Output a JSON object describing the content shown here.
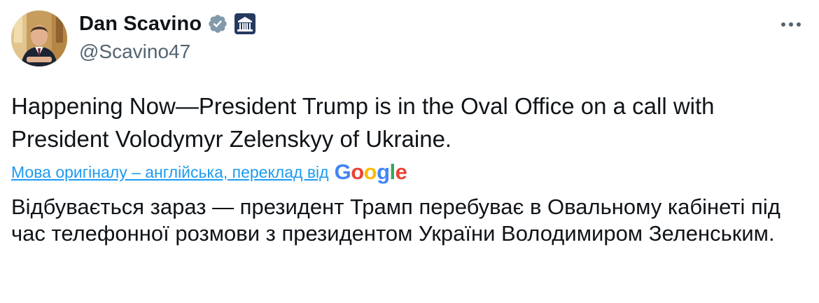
{
  "user": {
    "display_name": "Dan Scavino",
    "handle": "@Scavino47",
    "verified_icon": "verified-badge-icon",
    "affiliation_icon": "white-house-icon"
  },
  "menu": {
    "more_icon": "more-options-icon"
  },
  "tweet": {
    "text": "Happening Now—President Trump is in the Oval Office on a call with President Volodymyr Zelenskyy of Ukraine."
  },
  "translation": {
    "link_text": "Мова оригіналу – англійська, переклад від",
    "provider_logo": {
      "letters": [
        "G",
        "o",
        "o",
        "g",
        "l",
        "e"
      ]
    },
    "translated_text": "Відбувається зараз — президент Трамп перебуває в Овальному кабінеті під час телефонної розмови з президентом України Володимиром Зеленським."
  },
  "colors": {
    "link": "#1d9bf0",
    "verified_badge": "#829aab",
    "secondary_text": "#536471",
    "primary_text": "#0f1419"
  }
}
